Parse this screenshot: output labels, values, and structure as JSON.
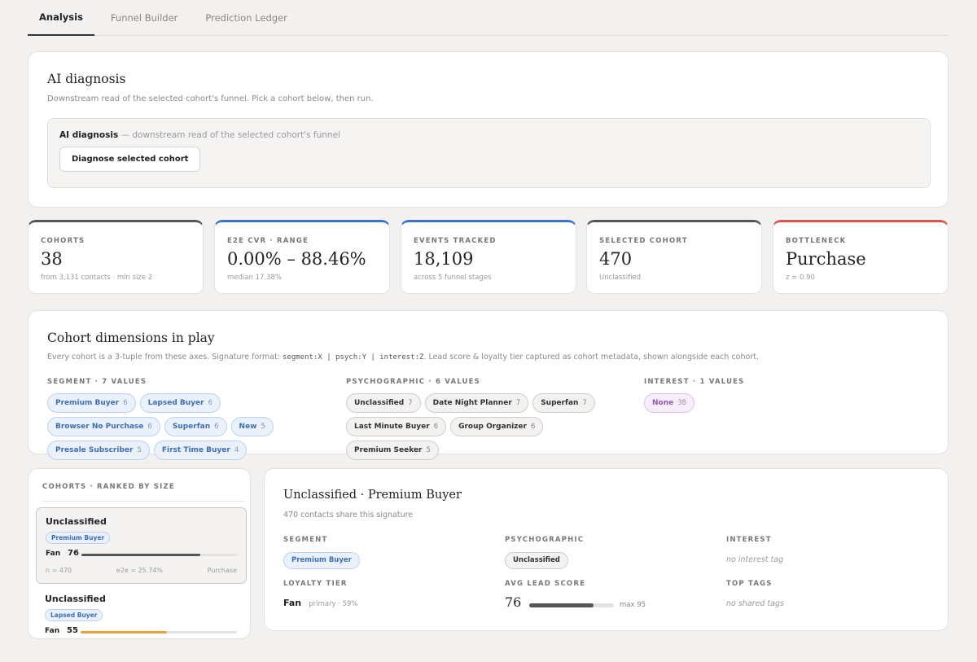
{
  "tabs": [
    "Analysis",
    "Funnel Builder",
    "Prediction Ledger"
  ],
  "ai": {
    "title": "AI diagnosis",
    "subtitle": "Downstream read of the selected cohort's funnel. Pick a cohort below, then run.",
    "inner_title_bold": "AI diagnosis",
    "inner_title_rest": " — downstream read of the selected cohort's funnel",
    "button": "Diagnose selected cohort"
  },
  "stats": [
    {
      "label": "COHORTS",
      "value": "38",
      "note": "from 3,131 contacts · min size 2",
      "color": "#555555"
    },
    {
      "label": "E2E CVR · RANGE",
      "value": "0.00% – 88.46%",
      "note": "median 17.38%",
      "color": "#3b74c8"
    },
    {
      "label": "EVENTS TRACKED",
      "value": "18,109",
      "note": "across 5 funnel stages",
      "color": "#3b74c8"
    },
    {
      "label": "SELECTED COHORT",
      "value": "470",
      "note": "Unclassified",
      "color": "#555555"
    },
    {
      "label": "BOTTLENECK",
      "value": "Purchase",
      "note": "z = 0.90",
      "color": "#d9534f"
    }
  ],
  "dims": {
    "title": "Cohort dimensions in play",
    "desc_pre": "Every cohort is a 3-tuple from these axes. Signature format: ",
    "desc_code": "segment:X | psych:Y | interest:Z",
    "desc_post": ". Lead score & loyalty tier captured as cohort metadata, shown alongside each cohort.",
    "segment": {
      "head": "SEGMENT · 7 VALUES",
      "chips": [
        {
          "label": "Premium Buyer",
          "n": "6"
        },
        {
          "label": "Lapsed Buyer",
          "n": "6"
        },
        {
          "label": "Browser No Purchase",
          "n": "6"
        },
        {
          "label": "Superfan",
          "n": "6"
        },
        {
          "label": "New",
          "n": "5"
        },
        {
          "label": "Presale Subscriber",
          "n": "5"
        },
        {
          "label": "First Time Buyer",
          "n": "4"
        }
      ]
    },
    "psych": {
      "head": "PSYCHOGRAPHIC · 6 VALUES",
      "chips": [
        {
          "label": "Unclassified",
          "n": "7"
        },
        {
          "label": "Date Night Planner",
          "n": "7"
        },
        {
          "label": "Superfan",
          "n": "7"
        },
        {
          "label": "Last Minute Buyer",
          "n": "6"
        },
        {
          "label": "Group Organizer",
          "n": "6"
        },
        {
          "label": "Premium Seeker",
          "n": "5"
        }
      ]
    },
    "interest": {
      "head": "INTEREST · 1 VALUES",
      "chips": [
        {
          "label": "None",
          "n": "38"
        }
      ]
    }
  },
  "cohorts": {
    "head": "COHORTS · RANKED BY SIZE",
    "items": [
      {
        "title": "Unclassified",
        "segment": "Premium Buyer",
        "tier": "Fan",
        "score": "76",
        "score_pct": 0.76,
        "bar_color": "#555555",
        "n": "n = 470",
        "e2e": "e2e = 25.74%",
        "stage": "Purchase"
      },
      {
        "title": "Unclassified",
        "segment": "Lapsed Buyer",
        "tier": "Fan",
        "score": "55",
        "score_pct": 0.55,
        "bar_color": "#e8a23a",
        "n": "",
        "e2e": "",
        "stage": ""
      }
    ]
  },
  "detail": {
    "title": "Unclassified · Premium Buyer",
    "subtitle": "470 contacts share this signature",
    "segment_k": "SEGMENT",
    "segment_v": "Premium Buyer",
    "psych_k": "PSYCHOGRAPHIC",
    "psych_v": "Unclassified",
    "interest_k": "INTEREST",
    "interest_v": "no interest tag",
    "loyalty_k": "LOYALTY TIER",
    "loyalty_v": "Fan",
    "loyalty_note": "primary · 59%",
    "lead_k": "AVG LEAD SCORE",
    "lead_v": "76",
    "lead_pct": 0.76,
    "lead_max": "max 95",
    "tags_k": "TOP TAGS",
    "tags_v": "no shared tags"
  }
}
